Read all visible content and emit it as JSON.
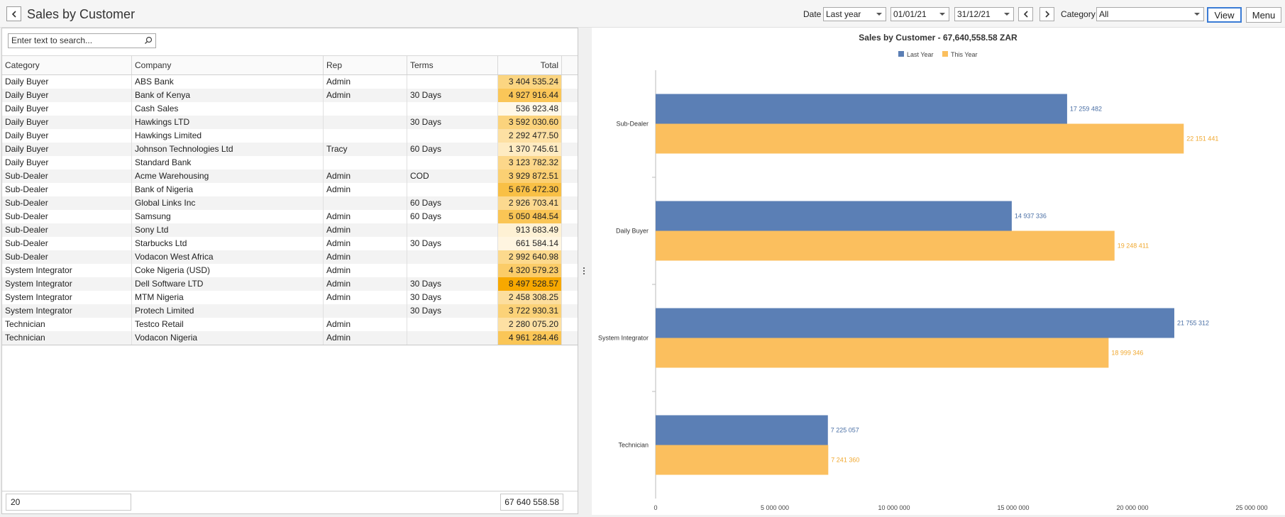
{
  "header": {
    "title": "Sales by Customer",
    "date_label": "Date",
    "date_range": "Last year",
    "start_date": "01/01/21",
    "end_date": "31/12/21",
    "category_label": "Category",
    "category": "All",
    "view_label": "View",
    "menu_label": "Menu"
  },
  "search": {
    "placeholder": "Enter text to search..."
  },
  "table": {
    "columns": [
      "Category",
      "Company",
      "Rep",
      "Terms",
      "Total"
    ],
    "rows": [
      {
        "category": "Daily Buyer",
        "company": "ABS Bank",
        "rep": "Admin",
        "terms": "",
        "total": "3 404 535.24",
        "value": 3404535.24
      },
      {
        "category": "Daily Buyer",
        "company": "Bank of Kenya",
        "rep": "Admin",
        "terms": "30 Days",
        "total": "4 927 916.44",
        "value": 4927916.44
      },
      {
        "category": "Daily Buyer",
        "company": "Cash Sales",
        "rep": "",
        "terms": "",
        "total": "536 923.48",
        "value": 536923.48
      },
      {
        "category": "Daily Buyer",
        "company": "Hawkings LTD",
        "rep": "",
        "terms": "30 Days",
        "total": "3 592 030.60",
        "value": 3592030.6
      },
      {
        "category": "Daily Buyer",
        "company": "Hawkings Limited",
        "rep": "",
        "terms": "",
        "total": "2 292 477.50",
        "value": 2292477.5
      },
      {
        "category": "Daily Buyer",
        "company": "Johnson Technologies Ltd",
        "rep": "Tracy",
        "terms": "60 Days",
        "total": "1 370 745.61",
        "value": 1370745.61
      },
      {
        "category": "Daily Buyer",
        "company": "Standard Bank",
        "rep": "",
        "terms": "",
        "total": "3 123 782.32",
        "value": 3123782.32
      },
      {
        "category": "Sub-Dealer",
        "company": "Acme Warehousing",
        "rep": "Admin",
        "terms": "COD",
        "total": "3 929 872.51",
        "value": 3929872.51
      },
      {
        "category": "Sub-Dealer",
        "company": "Bank of Nigeria",
        "rep": "Admin",
        "terms": "",
        "total": "5 676 472.30",
        "value": 5676472.3
      },
      {
        "category": "Sub-Dealer",
        "company": "Global Links Inc",
        "rep": "",
        "terms": "60 Days",
        "total": "2 926 703.41",
        "value": 2926703.41
      },
      {
        "category": "Sub-Dealer",
        "company": "Samsung",
        "rep": "Admin",
        "terms": "60 Days",
        "total": "5 050 484.54",
        "value": 5050484.54
      },
      {
        "category": "Sub-Dealer",
        "company": "Sony Ltd",
        "rep": "Admin",
        "terms": "",
        "total": "913 683.49",
        "value": 913683.49
      },
      {
        "category": "Sub-Dealer",
        "company": "Starbucks Ltd",
        "rep": "Admin",
        "terms": "30 Days",
        "total": "661 584.14",
        "value": 661584.14
      },
      {
        "category": "Sub-Dealer",
        "company": "Vodacon West Africa",
        "rep": "Admin",
        "terms": "",
        "total": "2 992 640.98",
        "value": 2992640.98
      },
      {
        "category": "System Integrator",
        "company": "Coke Nigeria (USD)",
        "rep": "Admin",
        "terms": "",
        "total": "4 320 579.23",
        "value": 4320579.23
      },
      {
        "category": "System Integrator",
        "company": "Dell Software LTD",
        "rep": "Admin",
        "terms": "30 Days",
        "total": "8 497 528.57",
        "value": 8497528.57
      },
      {
        "category": "System Integrator",
        "company": "MTM Nigeria",
        "rep": "Admin",
        "terms": "30 Days",
        "total": "2 458 308.25",
        "value": 2458308.25
      },
      {
        "category": "System Integrator",
        "company": "Protech Limited",
        "rep": "",
        "terms": "30 Days",
        "total": "3 722 930.31",
        "value": 3722930.31
      },
      {
        "category": "Technician",
        "company": "Testco Retail",
        "rep": "Admin",
        "terms": "",
        "total": "2 280 075.20",
        "value": 2280075.2
      },
      {
        "category": "Technician",
        "company": "Vodacon Nigeria",
        "rep": "Admin",
        "terms": "",
        "total": "4 961 284.46",
        "value": 4961284.46
      }
    ],
    "row_count": "20",
    "grand_total": "67 640 558.58"
  },
  "colors": {
    "last_year": "#5b7fb5",
    "this_year": "#fbbf5e",
    "heat_low": "#fff8e8",
    "heat_high": "#f7a800"
  },
  "chart_data": {
    "type": "bar",
    "orientation": "horizontal",
    "title": "Sales by Customer - 67,640,558.58 ZAR",
    "categories": [
      "Sub-Dealer",
      "Daily Buyer",
      "System Integrator",
      "Technician"
    ],
    "series": [
      {
        "name": "Last Year",
        "values": [
          17259482,
          14937336,
          21755312,
          7225057
        ],
        "labels": [
          "17 259 482",
          "14 937 336",
          "21 755 312",
          "7 225 057"
        ]
      },
      {
        "name": "This Year",
        "values": [
          22151441,
          19248411,
          18999346,
          7241360
        ],
        "labels": [
          "22 151 441",
          "19 248 411",
          "18 999 346",
          "7 241 360"
        ]
      }
    ],
    "xlim": [
      0,
      25000000
    ],
    "xticks": [
      0,
      5000000,
      10000000,
      15000000,
      20000000,
      25000000
    ],
    "xtick_labels": [
      "0",
      "5 000 000",
      "10 000 000",
      "15 000 000",
      "20 000 000",
      "25 000 000"
    ],
    "legend": "top-center",
    "grid": false
  }
}
